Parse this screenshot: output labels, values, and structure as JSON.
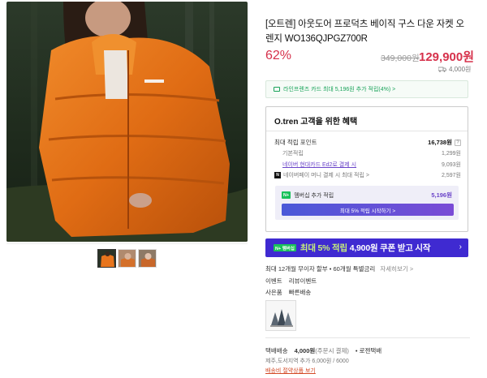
{
  "product": {
    "title": "[오트렌] 아웃도어 프로덕츠 베이직 구스 다운 자켓 오렌지 WO136QJPGZ700R",
    "discount": "62%",
    "original_price": "349,000원",
    "sale_price": "129,900원",
    "shipping_small": "4,000원"
  },
  "card_benefit": {
    "text": "라인프렌즈 카드 최대 5,196원 추가 적립(4%) >"
  },
  "benefits": {
    "heading": "O.tren 고객을 위한 혜택",
    "max_points_label": "최대 적립 포인트",
    "max_points_value": "16,738원",
    "help": "?",
    "rows": [
      {
        "label": "기본적립",
        "value": "1,299원"
      },
      {
        "label": "네이버 현대카드 Ed2로 결제 시",
        "value": "9,093원"
      },
      {
        "label": "네이버페이 머니 결제 시 최대 적립 >",
        "value": "2,597원"
      }
    ],
    "member_badge": "N+",
    "member_label": "멤버십 추가 적립",
    "member_value": "5,196원",
    "member_button": "최대 5% 적립 시작하기 >"
  },
  "promo": {
    "badge": "N+ 멤버십",
    "text_a": "최대 5% 적립",
    "text_b": "4,900원 쿠폰 받고 시작",
    "chevron": "›"
  },
  "installment": {
    "text": "최대 12개월 무이자 할부 • 60개월 특별금리",
    "more": "자세히보기 >"
  },
  "event": {
    "label": "이벤트",
    "value": "리뷰이벤트"
  },
  "gift": {
    "label": "사은품",
    "value": "빠른배송"
  },
  "shipping": {
    "label": "택배배송",
    "fee": "4,000원",
    "condition": "(주문시 결제)",
    "carrier": "• 로젠택배",
    "extra": "제주,도서지역 추가 6,000원 / 6000",
    "link": "배송비 절약상품 보기"
  },
  "colors": {
    "accent_red": "#d6314b",
    "naver_green": "#19c15b",
    "purple": "#6b45c9",
    "promo_bg": "#3f2ad1",
    "jacket_orange": "#e8751d"
  }
}
